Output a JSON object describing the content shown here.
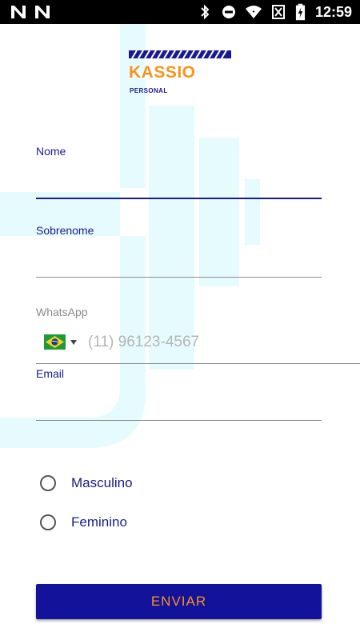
{
  "status_bar": {
    "time": "12:59",
    "left_icons": [
      "n-notification-icon",
      "n-notification-icon"
    ],
    "right_icons": [
      "bluetooth-icon",
      "do-not-disturb-icon",
      "wifi-icon",
      "no-sim-icon",
      "battery-charging-icon"
    ]
  },
  "logo": {
    "brand": "KASSIO",
    "subtitle": "PERSONAL"
  },
  "form": {
    "nome": {
      "label": "Nome",
      "value": ""
    },
    "sobrenome": {
      "label": "Sobrenome",
      "value": ""
    },
    "whatsapp": {
      "label": "WhatsApp",
      "country_flag": "brazil-flag-icon",
      "placeholder": "(11) 96123-4567",
      "value": ""
    },
    "email": {
      "label": "Email",
      "value": ""
    },
    "gender_options": [
      {
        "label": "Masculino",
        "selected": false
      },
      {
        "label": "Feminino",
        "selected": false
      }
    ],
    "submit_label": "ENVIAR"
  },
  "colors": {
    "primary": "#13129a",
    "accent": "#f7941d",
    "label": "#1a1a8c",
    "decoration": "#e6fbfd"
  }
}
